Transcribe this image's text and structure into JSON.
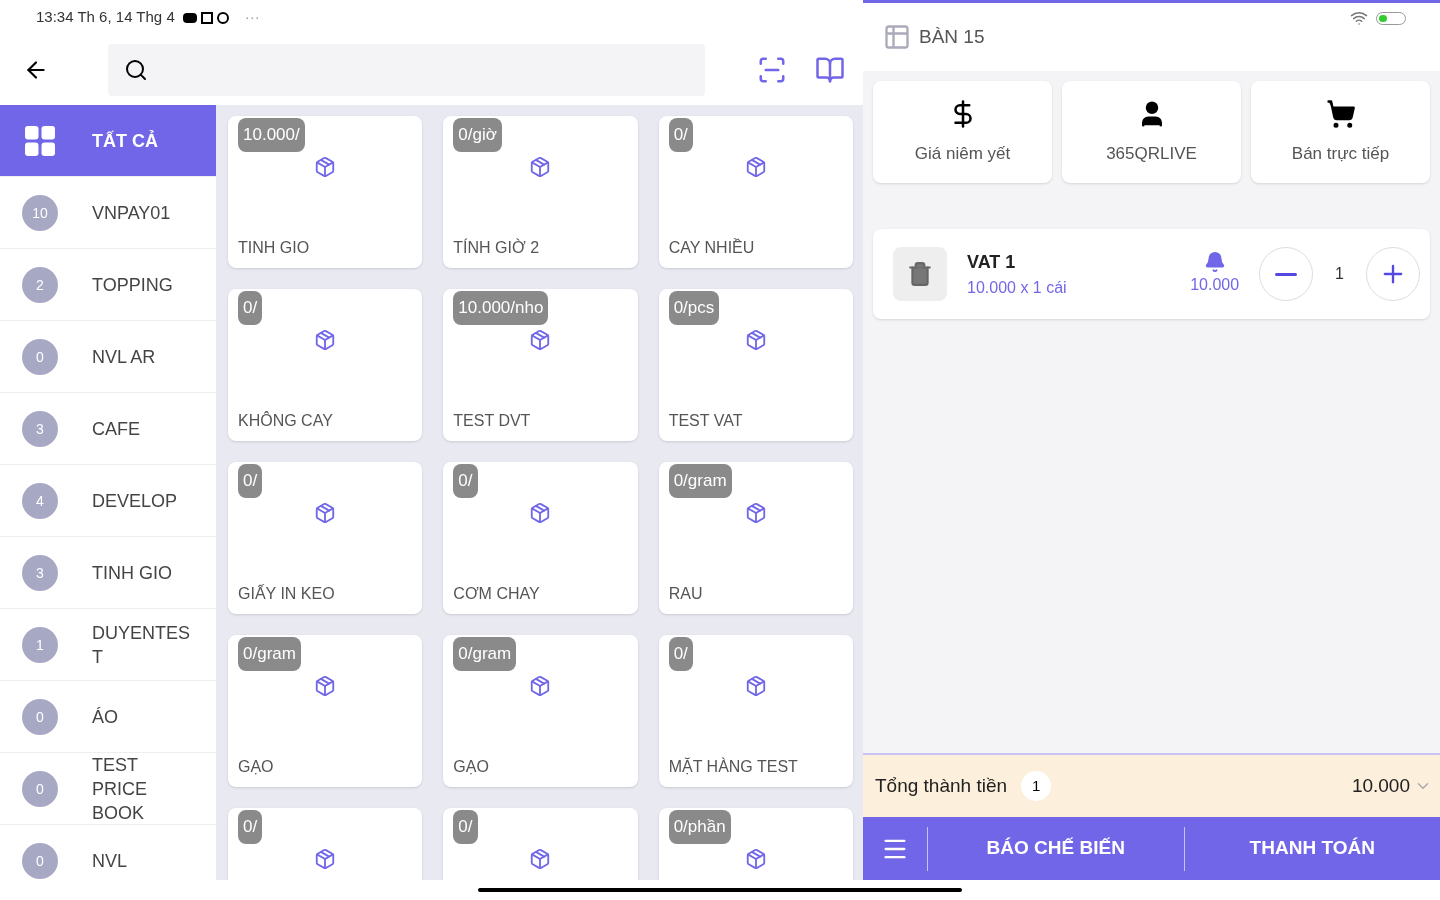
{
  "status_bar": {
    "time": "13:34 Th 6, 14 Thg 4",
    "more": "···"
  },
  "sidebar": {
    "items": [
      {
        "kind": "all",
        "label": "TẤT CẢ",
        "selected": true
      },
      {
        "kind": "group",
        "label": "VNPAY01",
        "count": "10",
        "selected": false
      },
      {
        "kind": "group",
        "label": "TOPPING",
        "count": "2",
        "selected": false
      },
      {
        "kind": "group",
        "label": "NVL AR",
        "count": "0",
        "selected": false
      },
      {
        "kind": "group",
        "label": "CAFE",
        "count": "3",
        "selected": false
      },
      {
        "kind": "group",
        "label": "DEVELOP",
        "count": "4",
        "selected": false
      },
      {
        "kind": "group",
        "label": "TINH GIO",
        "count": "3",
        "selected": false
      },
      {
        "kind": "group",
        "label": "DUYENTES T",
        "count": "1",
        "selected": false
      },
      {
        "kind": "group",
        "label": "ÁO",
        "count": "0",
        "selected": false
      },
      {
        "kind": "group",
        "label": "TEST PRICE BOOK",
        "count": "0",
        "selected": false
      },
      {
        "kind": "group",
        "label": "NVL",
        "count": "0",
        "selected": false
      }
    ]
  },
  "products": [
    {
      "tag": "10.000/",
      "name": "TINH GIO"
    },
    {
      "tag": "0/giờ",
      "name": "TÍNH GIỜ 2"
    },
    {
      "tag": "0/",
      "name": "CAY NHIỀU"
    },
    {
      "tag": "0/",
      "name": "KHÔNG CAY"
    },
    {
      "tag": "10.000/nho",
      "name": "TEST DVT"
    },
    {
      "tag": "0/pcs",
      "name": "TEST VAT"
    },
    {
      "tag": "0/",
      "name": "GIẤY IN KEO"
    },
    {
      "tag": "0/",
      "name": "CƠM CHAY"
    },
    {
      "tag": "0/gram",
      "name": "RAU"
    },
    {
      "tag": "0/gram",
      "name": "GẠO"
    },
    {
      "tag": "0/gram",
      "name": "GẠO"
    },
    {
      "tag": "0/",
      "name": "MẶT HÀNG TEST"
    },
    {
      "tag": "0/"
    },
    {
      "tag": "0/"
    },
    {
      "tag": "0/phần"
    }
  ],
  "order": {
    "table": "BÀN 15",
    "options": [
      {
        "kind": "price",
        "label": "Giá niêm yết"
      },
      {
        "kind": "customer",
        "label": "365QRLIVE"
      },
      {
        "kind": "sale",
        "label": "Bán trực tiếp"
      }
    ],
    "items": [
      {
        "name": "VAT 1",
        "detail": "10.000 x 1 cái",
        "amount": "10.000",
        "quantity": "1"
      }
    ],
    "total_label": "Tổng thành tiền",
    "total_count": "1",
    "total": "10.000",
    "actions": [
      "BÁO CHẾ BIẾN",
      "THANH TOÁN"
    ]
  }
}
